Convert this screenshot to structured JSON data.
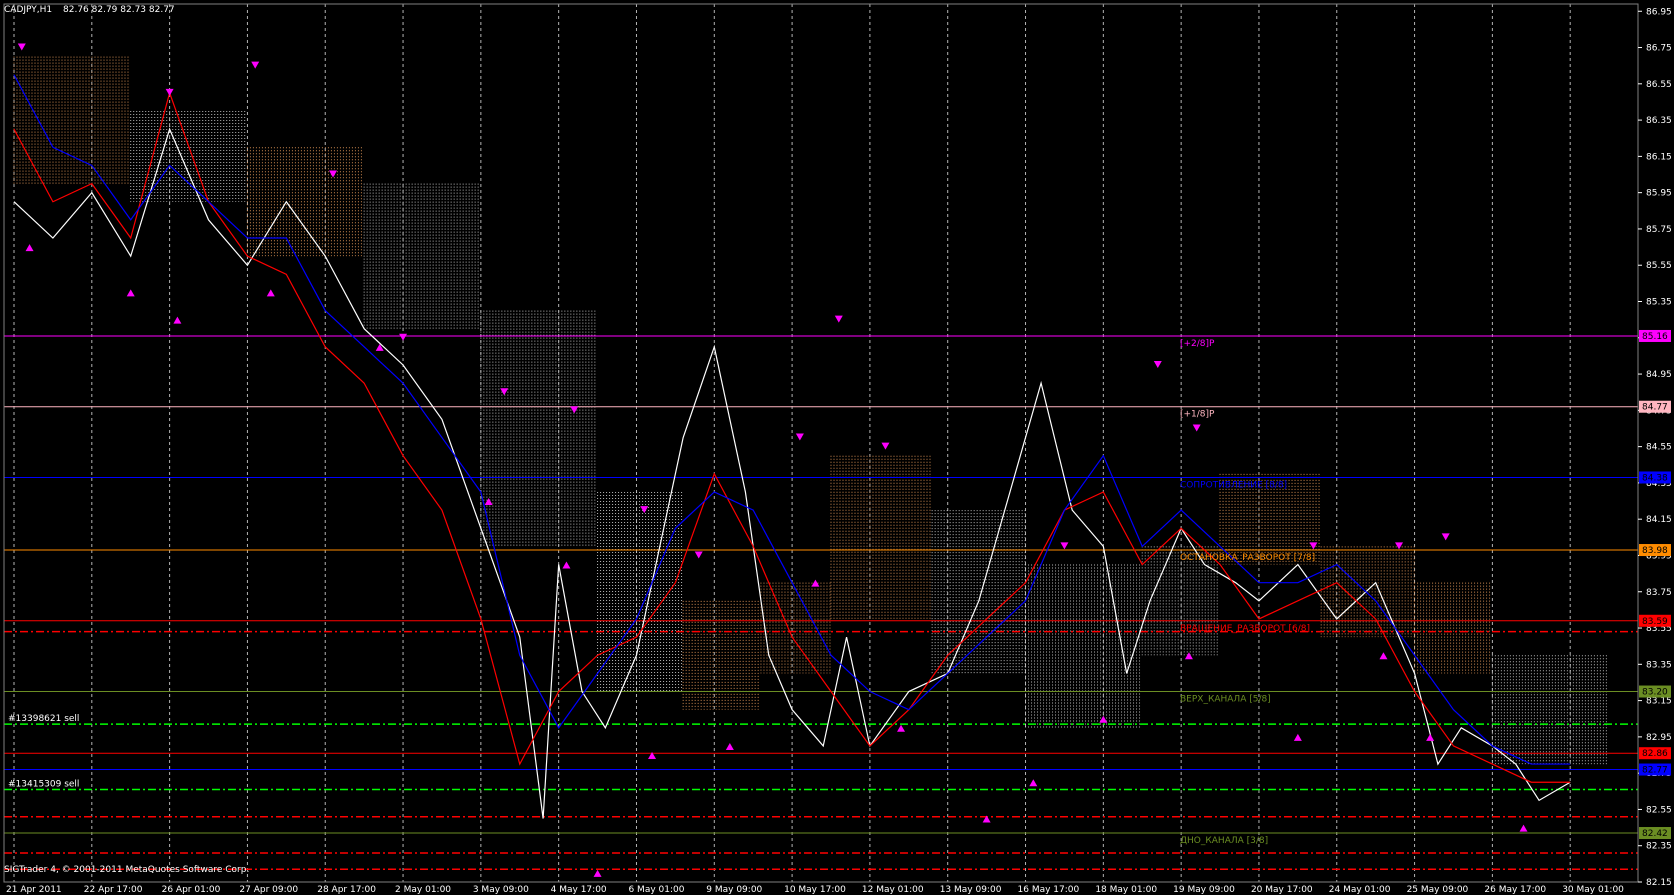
{
  "header": {
    "symbol": "CADJPY,H1",
    "ohlc": "82.76 82.79 82.73 82.77"
  },
  "copyright": "SIGTrader 4, © 2001-2011 MetaQuotes Software Corp.",
  "colors": {
    "background": "#000000",
    "grid": "#c8c8c8",
    "price_line_white": "#ffffff",
    "red_line": "#ff0000",
    "blue_line": "#0000ff",
    "arrow_magenta": "#ff00ff",
    "cloud_bull": "#f4a460",
    "cloud_bear": "#d8d8d8"
  },
  "icons": {
    "up_arrow": "fractal-up-arrow-icon",
    "down_arrow": "fractal-down-arrow-icon"
  },
  "chart_data": {
    "type": "line",
    "symbol": "CADJPY",
    "timeframe": "H1",
    "grid": true,
    "ylim": [
      82.15,
      86.99
    ],
    "y_ticks": [
      "86.95",
      "86.75",
      "86.55",
      "86.35",
      "86.15",
      "85.95",
      "85.75",
      "85.55",
      "85.35",
      "85.15",
      "84.95",
      "84.75",
      "84.55",
      "84.35",
      "84.15",
      "83.95",
      "83.75",
      "83.55",
      "83.35",
      "83.15",
      "82.95",
      "82.75",
      "82.55",
      "82.35",
      "82.15"
    ],
    "y_tick_values": [
      86.95,
      86.75,
      86.55,
      86.35,
      86.15,
      85.95,
      85.75,
      85.55,
      85.35,
      85.15,
      84.95,
      84.75,
      84.55,
      84.35,
      84.15,
      83.95,
      83.75,
      83.55,
      83.35,
      83.15,
      82.95,
      82.75,
      82.55,
      82.35,
      82.15
    ],
    "x_ticks": [
      "21 Apr 2011",
      "22 Apr 17:00",
      "26 Apr 01:00",
      "27 Apr 09:00",
      "28 Apr 17:00",
      "2 May 01:00",
      "3 May 09:00",
      "4 May 17:00",
      "6 May 01:00",
      "9 May 09:00",
      "10 May 17:00",
      "12 May 01:00",
      "13 May 09:00",
      "16 May 17:00",
      "18 May 01:00",
      "19 May 09:00",
      "20 May 17:00",
      "24 May 01:00",
      "25 May 09:00",
      "26 May 17:00",
      "30 May 01:00"
    ],
    "x_count": 21,
    "levels": [
      {
        "label": "[+2/8]P",
        "price_tag": "85.16",
        "value": 85.16,
        "color": "#ff00ff",
        "style": "solid"
      },
      {
        "label": "[+1/8]P",
        "price_tag": "84.77",
        "value": 84.77,
        "color": "#ffb6c1",
        "style": "solid"
      },
      {
        "label": "СОПРОТИВЛЕНИЕ [8/8]",
        "price_tag": "84.38",
        "value": 84.38,
        "color": "#0000ff",
        "style": "solid"
      },
      {
        "label": "ОСТАНОВКА_РАЗВОРОТ [7/8]",
        "price_tag": "83.98",
        "value": 83.98,
        "color": "#ff8c00",
        "style": "solid"
      },
      {
        "label": "ВРАЩЕНИЕ_РАЗВОРОТ [6/8]",
        "price_tag": "83.59",
        "value": 83.59,
        "color": "#ff0000",
        "style": "solid"
      },
      {
        "label": "ВЕРХ_КАНАЛА [5/8]",
        "price_tag": "83.20",
        "value": 83.2,
        "color": "#6b8e23",
        "style": "solid"
      },
      {
        "label": "",
        "price_tag": "82.86",
        "value": 82.86,
        "color": "#ff0000",
        "style": "solid"
      },
      {
        "label": "",
        "price_tag": "82.77",
        "value": 82.77,
        "color": "#0000ff",
        "style": "solid"
      },
      {
        "label": "ДНО_КАНАЛА [3/8]",
        "price_tag": "82.42",
        "value": 82.42,
        "color": "#6b8e23",
        "style": "solid"
      }
    ],
    "dashed_levels": [
      {
        "value": 83.53,
        "color": "#ff0000",
        "style": "dashdot"
      },
      {
        "value": 83.02,
        "color": "#00ff00",
        "style": "dashdot"
      },
      {
        "value": 82.66,
        "color": "#00ff00",
        "style": "dashdot"
      },
      {
        "value": 82.51,
        "color": "#ff0000",
        "style": "dashdot"
      },
      {
        "value": 82.31,
        "color": "#ff0000",
        "style": "dashdot"
      },
      {
        "value": 82.22,
        "color": "#ff0000",
        "style": "dashdot"
      }
    ],
    "orders": [
      {
        "label": "#13398621 sell",
        "value": 83.02
      },
      {
        "label": "#13415309 sell",
        "value": 82.66
      }
    ],
    "series": [
      {
        "kind": "price",
        "color": "#ffffff",
        "x": [
          0,
          0.5,
          1.0,
          1.5,
          2.0,
          2.5,
          3.0,
          3.5,
          4.0,
          4.5,
          5.0,
          5.5,
          6.0,
          6.5,
          6.8,
          7.0,
          7.3,
          7.6,
          8.0,
          8.3,
          8.6,
          9.0,
          9.4,
          9.7,
          10.0,
          10.4,
          10.7,
          11.0,
          11.5,
          12.0,
          12.4,
          12.8,
          13.2,
          13.6,
          14.0,
          14.3,
          14.6,
          15.0,
          15.3,
          15.7,
          16.0,
          16.5,
          17.0,
          17.5,
          18.0,
          18.3,
          18.6,
          19.0,
          19.3,
          19.6,
          20.0
        ],
        "y": [
          85.9,
          85.7,
          85.95,
          85.6,
          86.3,
          85.8,
          85.55,
          85.9,
          85.6,
          85.2,
          85.0,
          84.7,
          84.1,
          83.5,
          82.5,
          83.9,
          83.2,
          83.0,
          83.4,
          84.0,
          84.6,
          85.1,
          84.3,
          83.4,
          83.1,
          82.9,
          83.5,
          82.9,
          83.2,
          83.3,
          83.7,
          84.3,
          84.9,
          84.2,
          84.0,
          83.3,
          83.7,
          84.1,
          83.9,
          83.8,
          83.7,
          83.9,
          83.6,
          83.8,
          83.3,
          82.8,
          83.0,
          82.9,
          82.8,
          82.6,
          82.7
        ]
      },
      {
        "kind": "indicator",
        "color": "#ff0000",
        "x": [
          0,
          0.5,
          1.0,
          1.5,
          2.0,
          2.5,
          3.0,
          3.5,
          4.0,
          4.5,
          5.0,
          5.5,
          6.0,
          6.5,
          7.0,
          7.5,
          8.0,
          8.5,
          9.0,
          9.5,
          10.0,
          10.5,
          11.0,
          11.5,
          12.0,
          12.5,
          13.0,
          13.5,
          14.0,
          14.5,
          15.0,
          15.5,
          16.0,
          16.5,
          17.0,
          17.5,
          18.0,
          18.5,
          19.0,
          19.5,
          20.0
        ],
        "y": [
          86.3,
          85.9,
          86.0,
          85.7,
          86.5,
          85.9,
          85.6,
          85.5,
          85.1,
          84.9,
          84.5,
          84.2,
          83.6,
          82.8,
          83.2,
          83.4,
          83.5,
          83.8,
          84.4,
          84.0,
          83.5,
          83.2,
          82.9,
          83.1,
          83.4,
          83.6,
          83.8,
          84.2,
          84.3,
          83.9,
          84.1,
          83.9,
          83.6,
          83.7,
          83.8,
          83.6,
          83.2,
          82.9,
          82.8,
          82.7,
          82.7
        ]
      },
      {
        "kind": "indicator",
        "color": "#0000ff",
        "x": [
          0,
          0.5,
          1.0,
          1.5,
          2.0,
          2.5,
          3.0,
          3.5,
          4.0,
          4.5,
          5.0,
          5.5,
          6.0,
          6.5,
          7.0,
          7.5,
          8.0,
          8.5,
          9.0,
          9.5,
          10.0,
          10.5,
          11.0,
          11.5,
          12.0,
          12.5,
          13.0,
          13.5,
          14.0,
          14.5,
          15.0,
          15.5,
          16.0,
          16.5,
          17.0,
          17.5,
          18.0,
          18.5,
          19.0,
          19.5,
          20.0
        ],
        "y": [
          86.6,
          86.2,
          86.1,
          85.8,
          86.1,
          85.9,
          85.7,
          85.7,
          85.3,
          85.1,
          84.9,
          84.6,
          84.3,
          83.4,
          83.0,
          83.3,
          83.6,
          84.1,
          84.3,
          84.2,
          83.8,
          83.4,
          83.2,
          83.1,
          83.3,
          83.5,
          83.7,
          84.2,
          84.5,
          84.0,
          84.2,
          84.0,
          83.8,
          83.8,
          83.9,
          83.7,
          83.4,
          83.1,
          82.9,
          82.8,
          82.8
        ]
      }
    ],
    "clouds": [
      {
        "x0": 0.0,
        "x1": 1.5,
        "top": 86.7,
        "bottom": 86.0,
        "kind": "bull"
      },
      {
        "x0": 1.5,
        "x1": 3.0,
        "top": 86.4,
        "bottom": 85.9,
        "kind": "bear"
      },
      {
        "x0": 3.0,
        "x1": 4.5,
        "top": 86.2,
        "bottom": 85.6,
        "kind": "bull"
      },
      {
        "x0": 4.5,
        "x1": 6.0,
        "top": 86.0,
        "bottom": 85.2,
        "kind": "bear"
      },
      {
        "x0": 6.0,
        "x1": 7.5,
        "top": 85.3,
        "bottom": 84.0,
        "kind": "bear"
      },
      {
        "x0": 7.5,
        "x1": 8.6,
        "top": 84.3,
        "bottom": 83.2,
        "kind": "bear"
      },
      {
        "x0": 8.6,
        "x1": 9.6,
        "top": 83.7,
        "bottom": 83.1,
        "kind": "bull"
      },
      {
        "x0": 9.6,
        "x1": 10.5,
        "top": 83.8,
        "bottom": 83.3,
        "kind": "bull"
      },
      {
        "x0": 10.5,
        "x1": 11.8,
        "top": 84.5,
        "bottom": 83.6,
        "kind": "bull"
      },
      {
        "x0": 11.8,
        "x1": 13.0,
        "top": 84.2,
        "bottom": 83.3,
        "kind": "bear"
      },
      {
        "x0": 13.0,
        "x1": 14.5,
        "top": 83.9,
        "bottom": 83.0,
        "kind": "bear"
      },
      {
        "x0": 14.5,
        "x1": 15.5,
        "top": 84.0,
        "bottom": 83.4,
        "kind": "bear"
      },
      {
        "x0": 15.5,
        "x1": 16.8,
        "top": 84.4,
        "bottom": 83.9,
        "kind": "bull"
      },
      {
        "x0": 16.8,
        "x1": 18.0,
        "top": 84.0,
        "bottom": 83.5,
        "kind": "bull"
      },
      {
        "x0": 18.0,
        "x1": 19.0,
        "top": 83.8,
        "bottom": 83.3,
        "kind": "bull"
      },
      {
        "x0": 19.0,
        "x1": 20.5,
        "top": 83.4,
        "bottom": 82.8,
        "kind": "bear"
      }
    ],
    "arrows_down": [
      [
        0.1,
        86.75
      ],
      [
        2.0,
        86.5
      ],
      [
        3.1,
        86.65
      ],
      [
        4.1,
        86.05
      ],
      [
        5.0,
        85.15
      ],
      [
        6.3,
        84.85
      ],
      [
        7.2,
        84.75
      ],
      [
        8.1,
        84.2
      ],
      [
        8.8,
        83.95
      ],
      [
        10.1,
        84.6
      ],
      [
        10.6,
        85.25
      ],
      [
        11.2,
        84.55
      ],
      [
        13.5,
        84.0
      ],
      [
        14.7,
        85.0
      ],
      [
        15.2,
        84.65
      ],
      [
        16.7,
        84.0
      ],
      [
        17.8,
        84.0
      ],
      [
        18.4,
        84.05
      ]
    ],
    "arrows_up": [
      [
        0.2,
        85.65
      ],
      [
        1.5,
        85.4
      ],
      [
        2.1,
        85.25
      ],
      [
        3.3,
        85.4
      ],
      [
        4.7,
        85.1
      ],
      [
        6.1,
        84.25
      ],
      [
        7.1,
        83.9
      ],
      [
        7.5,
        82.2
      ],
      [
        8.2,
        82.85
      ],
      [
        9.2,
        82.9
      ],
      [
        10.3,
        83.8
      ],
      [
        11.4,
        83.0
      ],
      [
        12.5,
        82.5
      ],
      [
        13.1,
        82.7
      ],
      [
        14.0,
        83.05
      ],
      [
        15.1,
        83.4
      ],
      [
        16.5,
        82.95
      ],
      [
        17.6,
        83.4
      ],
      [
        18.2,
        82.95
      ],
      [
        19.4,
        82.45
      ]
    ]
  }
}
